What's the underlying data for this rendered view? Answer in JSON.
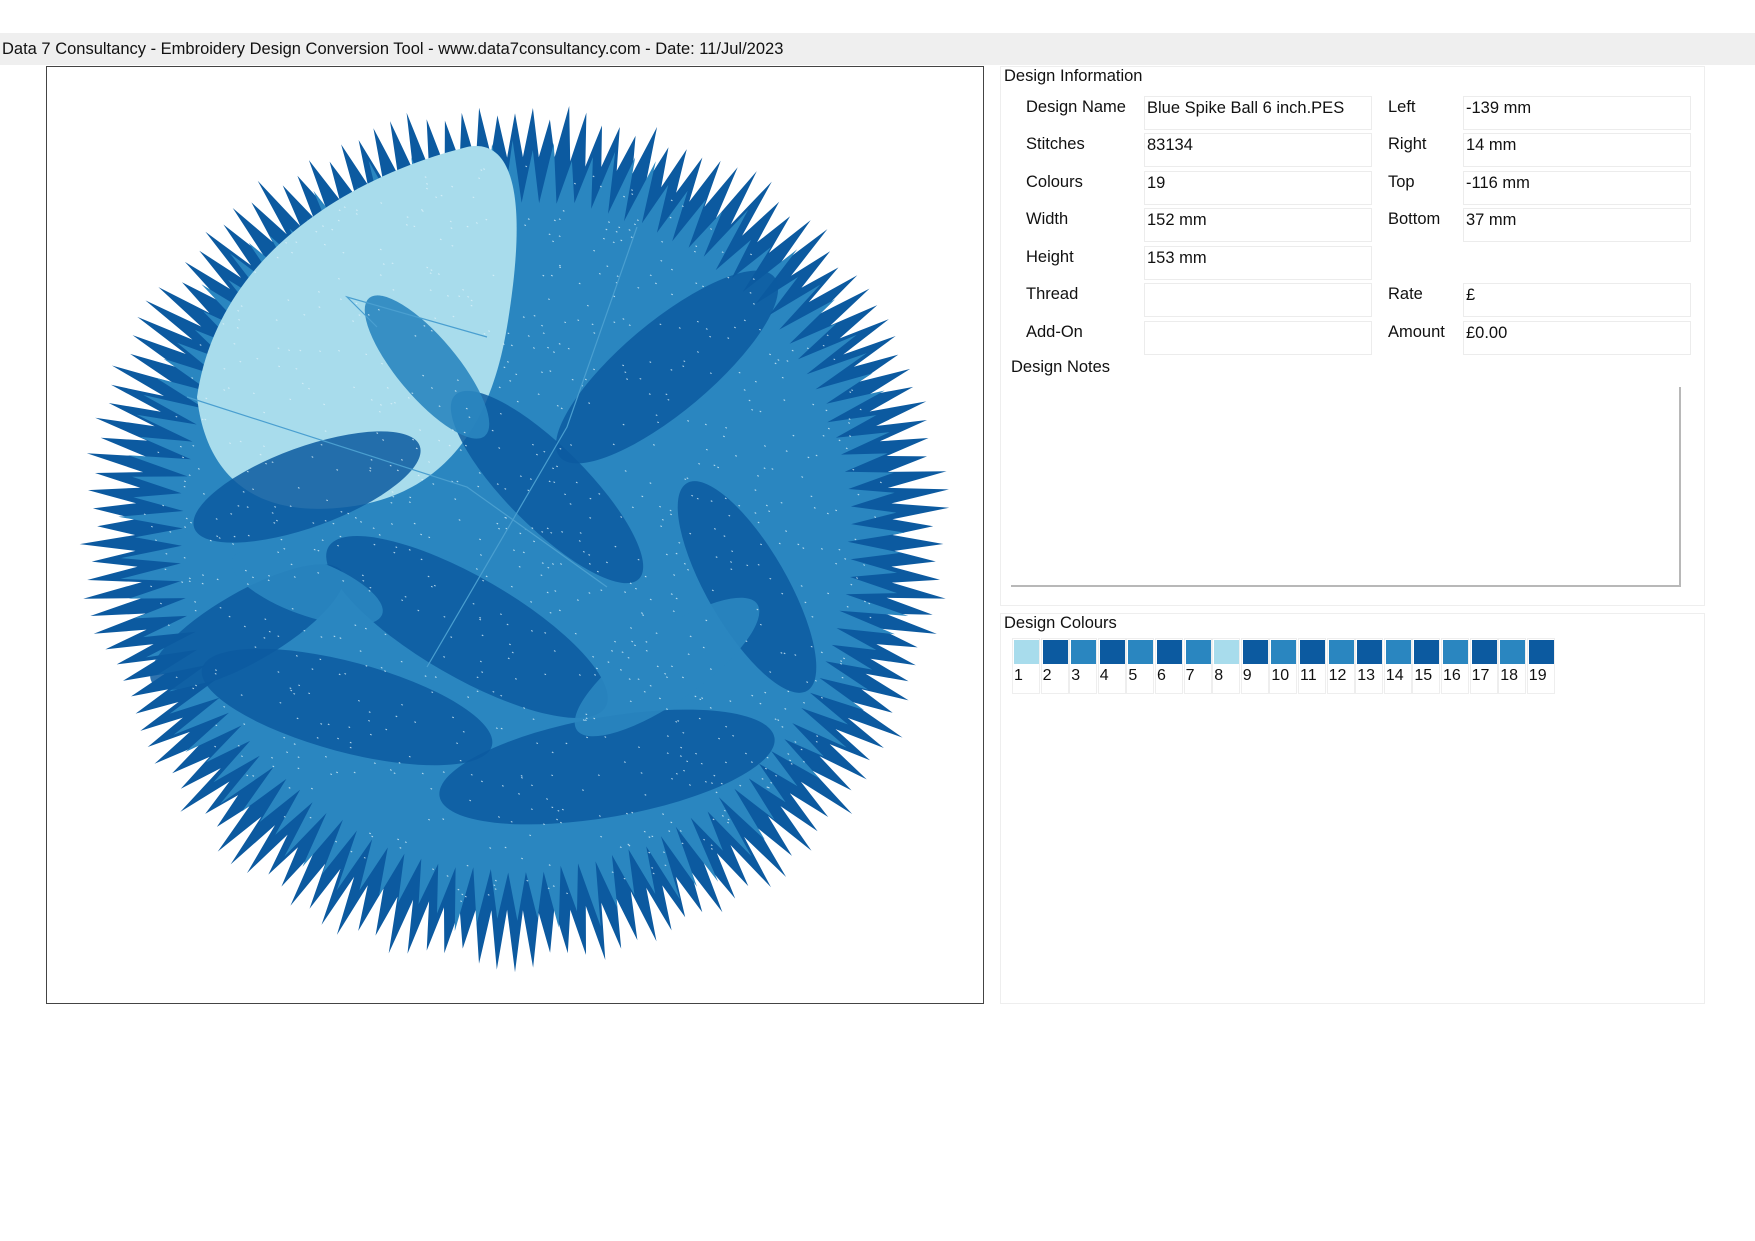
{
  "header": {
    "title": "Data 7 Consultancy - Embroidery Design Conversion Tool - www.data7consultancy.com - Date: 11/Jul/2023"
  },
  "design_information": {
    "title": "Design Information",
    "fields": {
      "design_name": {
        "label": "Design Name",
        "value": "Blue Spike Ball 6 inch.PES"
      },
      "stitches": {
        "label": "Stitches",
        "value": "83134"
      },
      "colours": {
        "label": "Colours",
        "value": "19"
      },
      "width": {
        "label": "Width",
        "value": "152 mm"
      },
      "height": {
        "label": "Height",
        "value": "153 mm"
      },
      "thread": {
        "label": "Thread",
        "value": ""
      },
      "add_on": {
        "label": "Add-On",
        "value": ""
      },
      "left": {
        "label": "Left",
        "value": "-139 mm"
      },
      "right": {
        "label": "Right",
        "value": "14 mm"
      },
      "top": {
        "label": "Top",
        "value": "-116 mm"
      },
      "bottom": {
        "label": "Bottom",
        "value": "37 mm"
      },
      "rate": {
        "label": "Rate",
        "value": "£"
      },
      "amount": {
        "label": "Amount",
        "value": "£0.00"
      }
    },
    "notes_label": "Design Notes",
    "notes_value": ""
  },
  "design_colours": {
    "title": "Design Colours",
    "swatches": [
      {
        "number": "1",
        "color": "#a8dcec"
      },
      {
        "number": "2",
        "color": "#0c5aa0"
      },
      {
        "number": "3",
        "color": "#2a86c0"
      },
      {
        "number": "4",
        "color": "#0c5aa0"
      },
      {
        "number": "5",
        "color": "#2a86c0"
      },
      {
        "number": "6",
        "color": "#0c5aa0"
      },
      {
        "number": "7",
        "color": "#2a86c0"
      },
      {
        "number": "8",
        "color": "#a8dcec"
      },
      {
        "number": "9",
        "color": "#0c5aa0"
      },
      {
        "number": "10",
        "color": "#2a86c0"
      },
      {
        "number": "11",
        "color": "#0c5aa0"
      },
      {
        "number": "12",
        "color": "#2a86c0"
      },
      {
        "number": "13",
        "color": "#0c5aa0"
      },
      {
        "number": "14",
        "color": "#2a86c0"
      },
      {
        "number": "15",
        "color": "#0c5aa0"
      },
      {
        "number": "16",
        "color": "#2a86c0"
      },
      {
        "number": "17",
        "color": "#0c5aa0"
      },
      {
        "number": "18",
        "color": "#2a86c0"
      },
      {
        "number": "19",
        "color": "#0c5aa0"
      }
    ]
  },
  "design_preview": {
    "description_colors": {
      "light": "#a8dcec",
      "mid": "#2a86c0",
      "dark": "#0c5aa0"
    }
  }
}
